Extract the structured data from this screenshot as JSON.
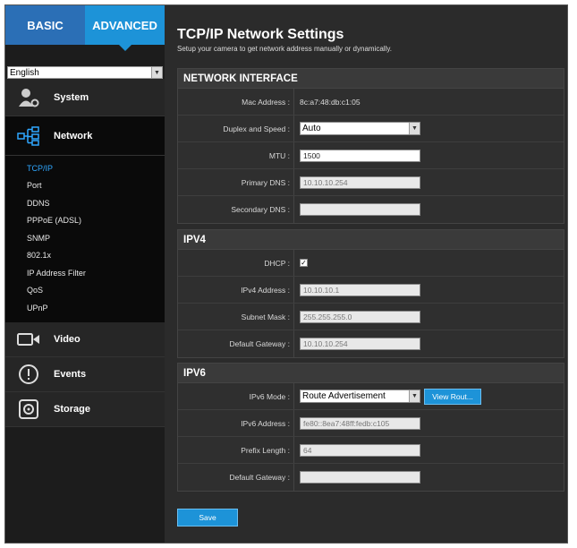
{
  "tabs": {
    "basic": "BASIC",
    "advanced": "ADVANCED"
  },
  "language": {
    "selected": "English"
  },
  "sidebar": {
    "system": "System",
    "network": "Network",
    "network_items": [
      "TCP/IP",
      "Port",
      "DDNS",
      "PPPoE (ADSL)",
      "SNMP",
      "802.1x",
      "IP Address Filter",
      "QoS",
      "UPnP"
    ],
    "video": "Video",
    "events": "Events",
    "storage": "Storage"
  },
  "page": {
    "title": "TCP/IP Network Settings",
    "subtitle": "Setup your camera to get network address manually or dynamically."
  },
  "network_interface": {
    "heading": "NETWORK INTERFACE",
    "mac_label": "Mac Address :",
    "mac_value": "8c:a7:48:db:c1:05",
    "duplex_label": "Duplex and Speed :",
    "duplex_value": "Auto",
    "mtu_label": "MTU :",
    "mtu_value": "1500",
    "primary_dns_label": "Primary DNS :",
    "primary_dns_value": "10.10.10.254",
    "secondary_dns_label": "Secondary DNS :",
    "secondary_dns_value": ""
  },
  "ipv4": {
    "heading": "IPV4",
    "dhcp_label": "DHCP :",
    "dhcp_checked": "☑",
    "address_label": "IPv4 Address :",
    "address_value": "10.10.10.1",
    "mask_label": "Subnet Mask :",
    "mask_value": "255.255.255.0",
    "gateway_label": "Default Gateway :",
    "gateway_value": "10.10.10.254"
  },
  "ipv6": {
    "heading": "IPV6",
    "mode_label": "IPv6 Mode :",
    "mode_value": "Route Advertisement",
    "view_route_label": "View Rout...",
    "address_label": "IPv6 Address :",
    "address_value": "fe80::8ea7:48ff:fedb:c105",
    "prefix_label": "Prefix Length :",
    "prefix_value": "64",
    "gateway_label": "Default Gateway :",
    "gateway_value": ""
  },
  "save_label": "Save"
}
